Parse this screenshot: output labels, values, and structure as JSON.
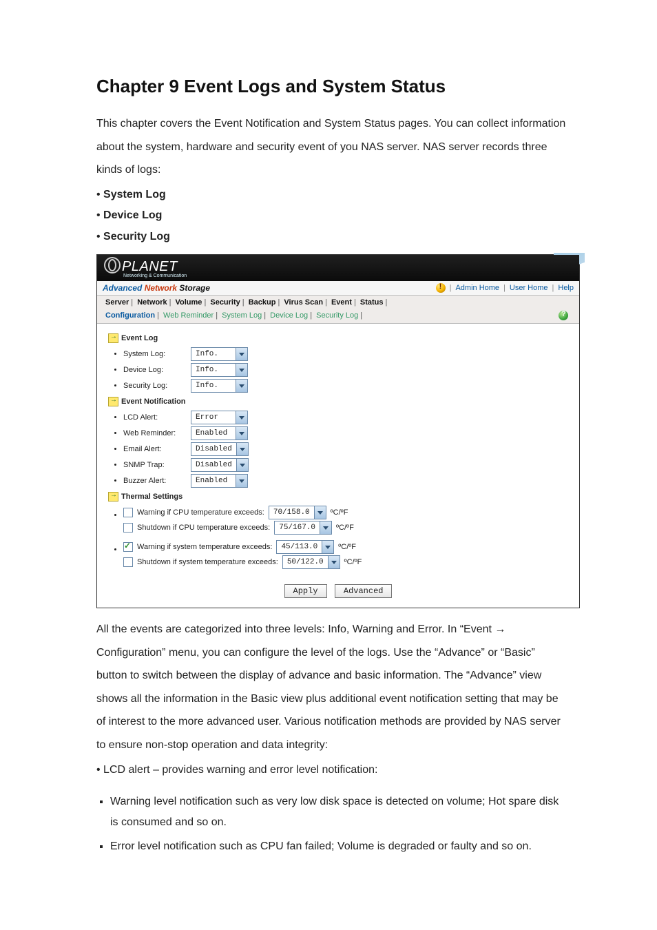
{
  "doc": {
    "title": "Chapter 9 Event Logs and System Status",
    "intro": "This chapter covers the Event Notification and System Status pages. You can collect information about the system, hardware and security event of you NAS server. NAS server records three kinds of logs:",
    "logs": [
      "System Log",
      "Device Log",
      "Security Log"
    ],
    "followup": "All the events are categorized into three levels: Info, Warning and Error. In “Event → Configuration” menu, you can configure the level of the logs. Use the “Advance” or “Basic” button to switch between the display of advance and basic information. The “Advance” view shows all the information in the Basic view plus additional event notification setting that may be of interest to the more advanced user. Various notification methods are provided by NAS server to ensure non-stop operation and data integrity:",
    "lcd_line": "LCD alert – provides warning and error level notification:",
    "sq1": "Warning level notification such as very low disk space is detected on volume; Hot spare disk is consumed and so on.",
    "sq2": "Error level notification such as CPU fan failed; Volume is degraded or faulty and so on."
  },
  "shot": {
    "brand": "PLANET",
    "brand_sub": "Networking & Communication",
    "product_a": "Advanced",
    "product_n": " Network ",
    "product_s": "Storage",
    "links": {
      "admin": "Admin Home",
      "user": "User Home",
      "help": "Help"
    },
    "tabs": [
      "Server",
      "Network",
      "Volume",
      "Security",
      "Backup",
      "Virus Scan",
      "Event",
      "Status"
    ],
    "subtabs": [
      {
        "label": "Configuration",
        "active": true
      },
      {
        "label": "Web Reminder",
        "active": false
      },
      {
        "label": "System Log",
        "active": false
      },
      {
        "label": "Device Log",
        "active": false
      },
      {
        "label": "Security Log",
        "active": false
      }
    ],
    "section1": {
      "title": "Event Log",
      "rows": [
        {
          "label": "System Log:",
          "value": "Info."
        },
        {
          "label": "Device Log:",
          "value": "Info."
        },
        {
          "label": "Security Log:",
          "value": "Info."
        }
      ]
    },
    "section2": {
      "title": "Event Notification",
      "rows": [
        {
          "label": "LCD Alert:",
          "value": "Error"
        },
        {
          "label": "Web Reminder:",
          "value": "Enabled"
        },
        {
          "label": "Email Alert:",
          "value": "Disabled"
        },
        {
          "label": "SNMP Trap:",
          "value": "Disabled"
        },
        {
          "label": "Buzzer Alert:",
          "value": "Enabled"
        }
      ]
    },
    "section3": {
      "title": "Thermal Settings",
      "unit": "ºC/ºF",
      "rows": [
        {
          "checked": false,
          "label": "Warning if CPU temperature exceeds:",
          "value": "70/158.0"
        },
        {
          "checked": false,
          "label": "Shutdown if CPU temperature exceeds:",
          "value": "75/167.0"
        },
        {
          "checked": true,
          "label": "Warning if system temperature exceeds:",
          "value": "45/113.0"
        },
        {
          "checked": false,
          "label": "Shutdown if system temperature exceeds:",
          "value": "50/122.0"
        }
      ]
    },
    "buttons": {
      "apply": "Apply",
      "advanced": "Advanced"
    }
  }
}
